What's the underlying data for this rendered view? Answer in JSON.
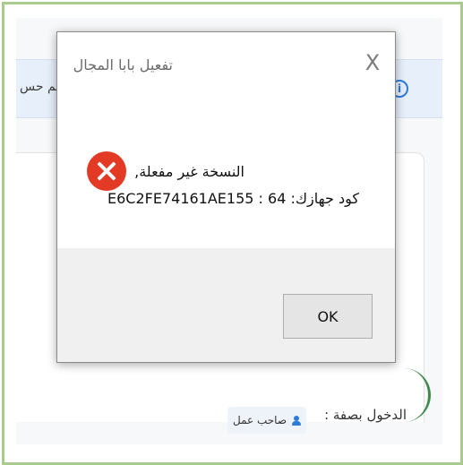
{
  "background": {
    "info_bar_partial_text": "تم حس",
    "login_as_label": "الدخول بصفة :",
    "role_button_label": "صاحب عمل",
    "icons": {
      "info": "info-icon",
      "user": "user-icon"
    }
  },
  "dialog": {
    "title": "تفعيل بابا المجال",
    "close_symbol": "X",
    "message_line1": "النسخة غير مفعلة,",
    "message_line2": "كود جهازك: E6C2FE74161AE155 : 64",
    "ok_label": "OK",
    "icon": "error-icon"
  },
  "colors": {
    "error_red": "#e33a26",
    "frame_green": "#a9cc8e",
    "accent_blue": "#2d7bd6"
  }
}
